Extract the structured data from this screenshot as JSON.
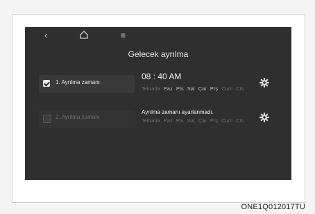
{
  "screen": {
    "title": "Gelecek ayrılma",
    "nav": {
      "back_icon": "‹",
      "menu_icon": "≡"
    }
  },
  "rows": [
    {
      "label": "1. Ayrılma zamanı",
      "checked": true,
      "time": "08 : 40 AM",
      "repeat_label": "Tekrarla",
      "days": [
        "Paz",
        "Pts",
        "Sal",
        "Çar",
        "Prş",
        "Cum",
        "Cts"
      ]
    },
    {
      "label": "2. Ayrılma zamanı",
      "checked": false,
      "message": "Ayrılma zamanı ayarlanmadı.",
      "repeat_label": "Tekrarla",
      "days": [
        "Paz",
        "Pts",
        "Sal",
        "Çar",
        "Prş",
        "Cum",
        "Cts"
      ]
    }
  ],
  "caption": "ONE1Q012017TU"
}
